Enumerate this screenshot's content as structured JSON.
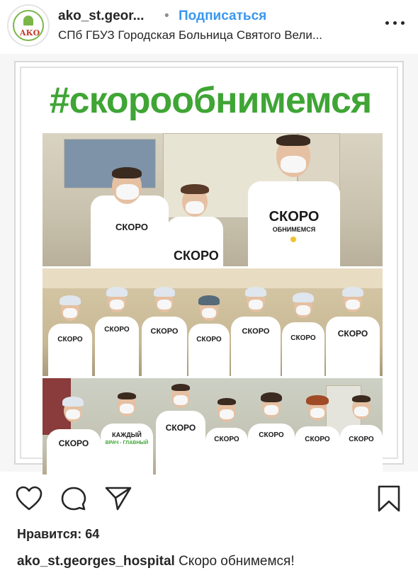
{
  "header": {
    "username": "ako_st.geor...",
    "separator": "•",
    "subscribe_label": "Подписаться",
    "location": "СПб ГБУЗ Городская Больница Святого Вели...",
    "avatar_text": "АКО",
    "more_icon": "more-horizontal-icon"
  },
  "post": {
    "hashtag": "#скорообнимемся",
    "shirt_text_line1": "СКОРО",
    "shirt_text_line2": "ОБНИМЕМСЯ",
    "shirt_alt_line1": "КАЖДЫЙ",
    "shirt_alt_line2": "ВРАЧ - ГЛАВНЫЙ"
  },
  "actions": {
    "like_icon": "heart-icon",
    "comment_icon": "comment-icon",
    "share_icon": "send-icon",
    "save_icon": "bookmark-icon"
  },
  "likes": {
    "text": "Нравится: 64"
  },
  "caption": {
    "username": "ako_st.georges_hospital",
    "text": "Скоро обнимемся!"
  },
  "colors": {
    "accent_green": "#3fa535",
    "link_blue": "#3897f0",
    "text": "#262626"
  }
}
